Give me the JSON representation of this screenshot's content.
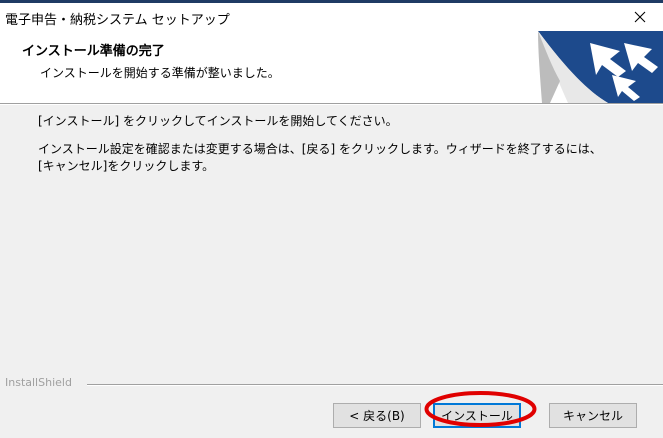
{
  "window": {
    "title": "電子申告・納税システム セットアップ",
    "close_symbol": "✕"
  },
  "header": {
    "title": "インストール準備の完了",
    "subtitle": "インストールを開始する準備が整いました。"
  },
  "content": {
    "line1": "[インストール] をクリックしてインストールを開始してください。",
    "line2": "インストール設定を確認または変更する場合は、[戻る] をクリックします。ウィザードを終了するには、",
    "line3": "[キャンセル]をクリックします。"
  },
  "footer": {
    "brand": "InstallShield"
  },
  "buttons": {
    "back": "< 戻る(B)",
    "install": "インストール",
    "cancel": "キャンセル"
  },
  "colors": {
    "title_strip": "#1f3b64",
    "logo_blue": "#1d4a8c",
    "annotation_red": "#e00000",
    "focus_blue": "#0078d7"
  },
  "icons": {
    "close": "close-icon",
    "logo": "installer-logo-icon"
  }
}
